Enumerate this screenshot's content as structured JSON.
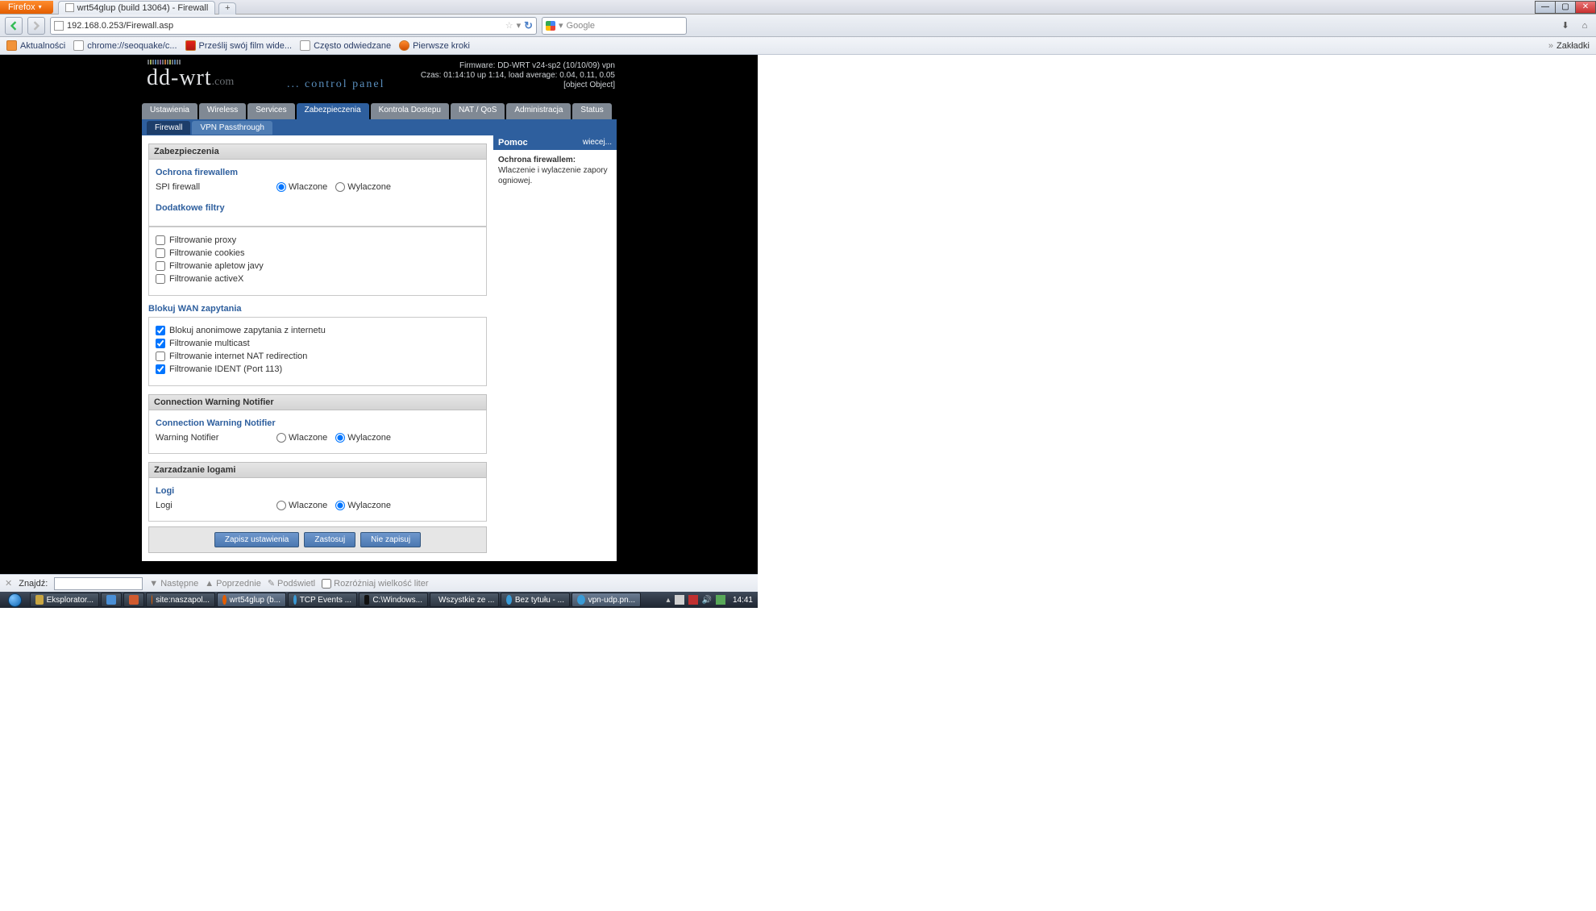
{
  "browser": {
    "name": "Firefox",
    "tab_title": "wrt54glup (build 13064) - Firewall",
    "url": "192.168.0.253/Firewall.asp",
    "search_placeholder": "Google",
    "bookmarks": [
      "Aktualności",
      "chrome://seoquake/c...",
      "Prześlij swój film wide...",
      "Często odwiedzane",
      "Pierwsze kroki"
    ],
    "bookmarks_btn": "Zakładki"
  },
  "router": {
    "logo_sub": ".com",
    "control_panel": "... control panel",
    "firmware": "Firmware: DD-WRT v24-sp2 (10/10/09) vpn",
    "uptime": "Czas: 01:14:10 up 1:14, load average: 0.04, 0.11, 0.05",
    "wan": {
      "title": "Blokuj WAN zapytania",
      "items": [
        "Blokuj anonimowe zapytania z internetu",
        "Filtrowanie multicast",
        "Filtrowanie internet NAT redirection",
        "Filtrowanie IDENT (Port 113)"
      ],
      "checked": [
        true,
        true,
        false,
        true
      ]
    },
    "tabs": [
      "Ustawienia",
      "Wireless",
      "Services",
      "Zabezpieczenia",
      "Kontrola Dostepu",
      "NAT / QoS",
      "Administracja",
      "Status"
    ],
    "subtabs": [
      "Firewall",
      "VPN Passthrough"
    ],
    "sec_zabez": "Zabezpieczenia",
    "fw": {
      "title": "Ochrona firewallem",
      "label": "SPI firewall",
      "on": "Wlaczone",
      "off": "Wylaczone"
    },
    "filters": {
      "title": "Dodatkowe filtry",
      "items": [
        "Filtrowanie proxy",
        "Filtrowanie cookies",
        "Filtrowanie apletow javy",
        "Filtrowanie activeX"
      ]
    },
    "cwn": {
      "hdr": "Connection Warning Notifier",
      "title": "Connection Warning Notifier",
      "label": "Warning Notifier"
    },
    "logs": {
      "hdr": "Zarzadzanie logami",
      "title": "Logi",
      "label": "Logi"
    },
    "buttons": [
      "Zapisz ustawienia",
      "Zastosuj",
      "Nie zapisuj"
    ],
    "help": {
      "hdr": "Pomoc",
      "more": "wiecej...",
      "title": "Ochrona firewallem:",
      "body": "Wlaczenie i wylaczenie zapory ogniowej."
    }
  },
  "findbar": {
    "label": "Znajdź:",
    "next": "Następne",
    "prev": "Poprzednie",
    "hl": "Podświetl",
    "case": "Rozróżniaj wielkość liter"
  },
  "taskbar": {
    "items": [
      "Eksplorator...",
      "",
      "",
      "site:naszapol...",
      "wrt54glup (b...",
      "TCP Events ...",
      "C:\\Windows...",
      "Wszystkie ze ...",
      "Bez tytułu - ...",
      "vpn-udp.pn..."
    ],
    "clock": "14:41"
  }
}
